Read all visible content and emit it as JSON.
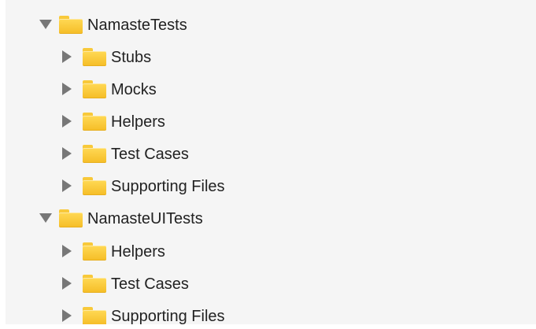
{
  "navigator": {
    "groups": [
      {
        "label": "NamasteTests",
        "children": [
          {
            "label": "Stubs"
          },
          {
            "label": "Mocks"
          },
          {
            "label": "Helpers"
          },
          {
            "label": "Test Cases"
          },
          {
            "label": "Supporting Files"
          }
        ]
      },
      {
        "label": "NamasteUITests",
        "children": [
          {
            "label": "Helpers"
          },
          {
            "label": "Test Cases"
          },
          {
            "label": "Supporting Files"
          }
        ]
      }
    ]
  },
  "icons": {
    "folder": "folder-icon",
    "expanded": "disclosure-expanded-icon",
    "collapsed": "disclosure-collapsed-icon"
  },
  "colors": {
    "folder_yellow": "#f5bd26",
    "background": "#f5f5f5",
    "disclosure": "#777777"
  }
}
